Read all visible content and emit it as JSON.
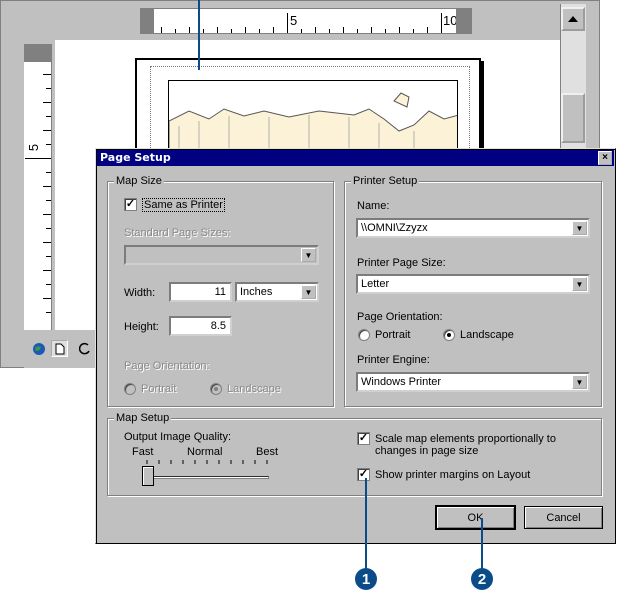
{
  "ruler": {
    "h_label_5": "5",
    "h_label_10": "10",
    "v_label_5": "5"
  },
  "dialog": {
    "title": "Page Setup",
    "close_label": "×",
    "map_size": {
      "group_label": "Map Size",
      "same_as_printer_label": "Same as Printer",
      "same_as_printer_checked": true,
      "standard_sizes_label": "Standard Page Sizes:",
      "standard_sizes_value": "",
      "width_label": "Width:",
      "width_value": "11",
      "width_units": "Inches",
      "height_label": "Height:",
      "height_value": "8.5",
      "orientation_label": "Page Orientation:",
      "portrait_label": "Portrait",
      "landscape_label": "Landscape",
      "selected_orientation": "Landscape"
    },
    "printer_setup": {
      "group_label": "Printer Setup",
      "name_label": "Name:",
      "name_value": "\\\\OMNI\\Zzyzx",
      "page_size_label": "Printer Page Size:",
      "page_size_value": "Letter",
      "orientation_label": "Page Orientation:",
      "portrait_label": "Portrait",
      "landscape_label": "Landscape",
      "selected_orientation": "Landscape",
      "engine_label": "Printer Engine:",
      "engine_value": "Windows Printer"
    },
    "map_setup": {
      "group_label": "Map Setup",
      "quality_label": "Output Image Quality:",
      "fast_label": "Fast",
      "normal_label": "Normal",
      "best_label": "Best",
      "quality_level": 0,
      "scale_label": "Scale map elements proportionally to changes in page size",
      "scale_checked": true,
      "show_margins_label": "Show printer margins on Layout",
      "show_margins_checked": true
    },
    "ok_label": "OK",
    "cancel_label": "Cancel"
  },
  "callouts": {
    "one": "1",
    "two": "2"
  },
  "colors": {
    "titlebar": "#000080",
    "callout": "#0a4c8a",
    "dialog_face": "#c0c0c0"
  }
}
